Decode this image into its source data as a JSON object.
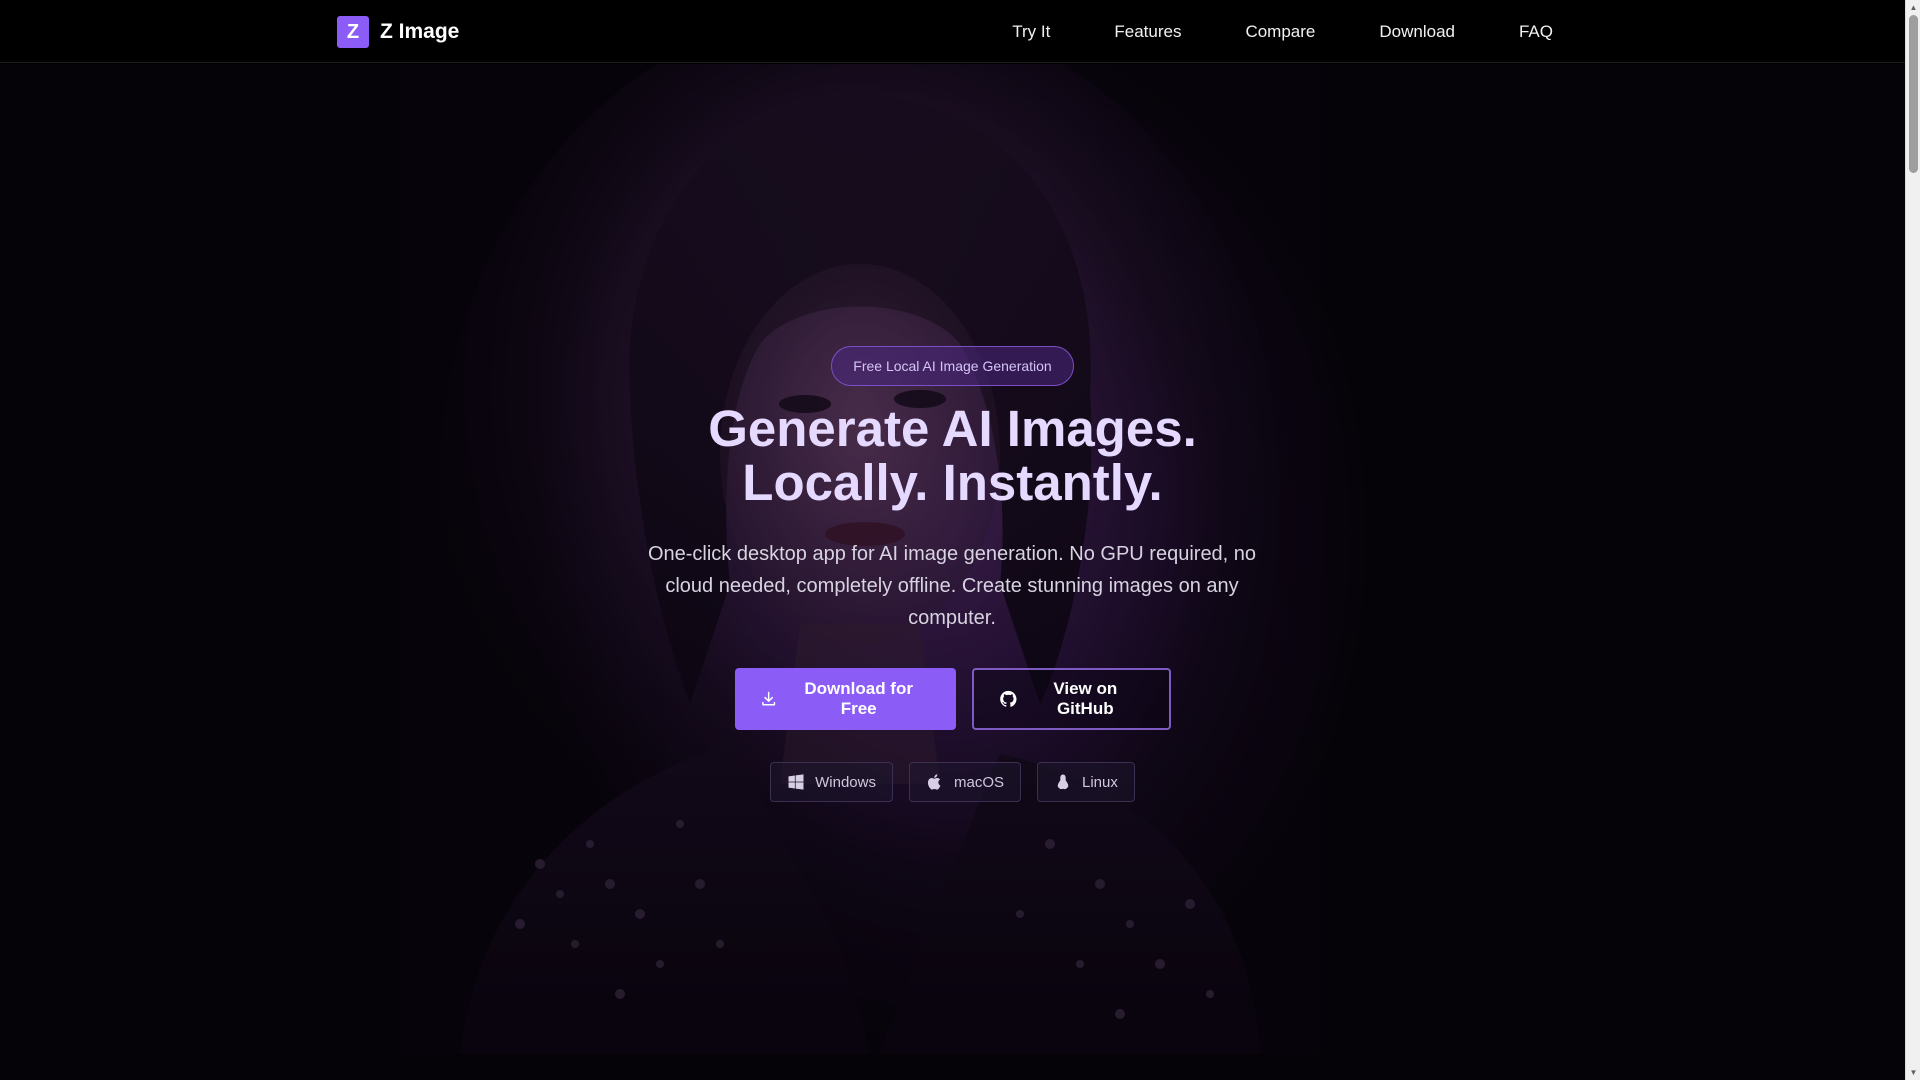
{
  "brand": {
    "logo_letter": "Z",
    "name": "Z Image"
  },
  "nav": {
    "items": [
      {
        "label": "Try It"
      },
      {
        "label": "Features"
      },
      {
        "label": "Compare"
      },
      {
        "label": "Download"
      },
      {
        "label": "FAQ"
      }
    ]
  },
  "hero": {
    "badge": "Free Local AI Image Generation",
    "headline_line1": "Generate AI Images.",
    "headline_line2": "Locally. Instantly.",
    "subtext": "One-click desktop app for AI image generation. No GPU required, no cloud needed, completely offline. Create stunning images on any computer.",
    "primary_button": {
      "label": "Download for Free",
      "icon": "download-icon"
    },
    "secondary_button": {
      "label": "View on GitHub",
      "icon": "github-icon"
    },
    "platforms": [
      {
        "label": "Windows",
        "icon": "windows-icon"
      },
      {
        "label": "macOS",
        "icon": "apple-icon"
      },
      {
        "label": "Linux",
        "icon": "linux-icon"
      }
    ]
  },
  "colors": {
    "accent": "#8b5cf6",
    "background": "#000000",
    "headline": "#e6d9ff",
    "glow": "#4a1f6e"
  }
}
